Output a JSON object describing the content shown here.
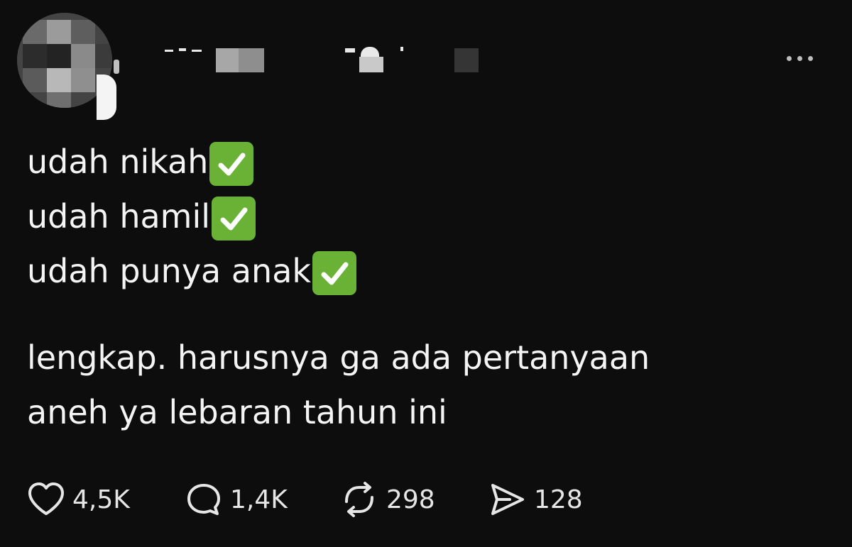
{
  "post": {
    "lines": [
      "udah nikah",
      "udah hamil",
      "udah punya anak"
    ],
    "paragraph": [
      "lengkap. harusnya ga ada pertanyaan",
      "aneh ya lebaran tahun ini"
    ],
    "check_icon": "white-check-mark-emoji"
  },
  "actions": {
    "like_count": "4,5K",
    "reply_count": "1,4K",
    "repost_count": "298",
    "share_count": "128"
  },
  "colors": {
    "background": "#0d0d0d",
    "text": "#f4f4f4",
    "check_green": "#69b236"
  }
}
